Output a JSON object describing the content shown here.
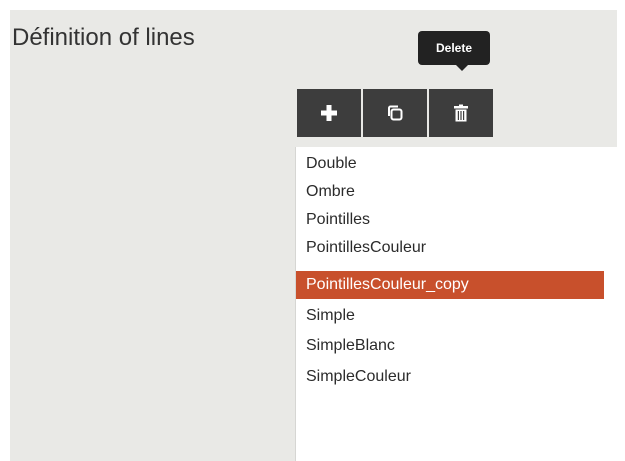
{
  "section": {
    "title": "Définition of lines"
  },
  "tooltip": {
    "text": "Delete"
  },
  "toolbar": {
    "buttons": [
      {
        "name": "add",
        "icon": "plus-icon"
      },
      {
        "name": "copy",
        "icon": "copy-icon"
      },
      {
        "name": "delete",
        "icon": "trash-icon"
      }
    ]
  },
  "line_list": {
    "items": [
      "Double",
      "Ombre",
      "Pointilles",
      "PointillesCouleur",
      "PointillesCouleur_copy",
      "Simple",
      "SimpleBlanc",
      "SimpleCouleur"
    ],
    "selected": "PointillesCouleur_copy"
  },
  "colors": {
    "panel_bg": "#e9e9e6",
    "button_bg": "#3d3d3d",
    "selected_bg": "#c8502c",
    "tooltip_bg": "#222222"
  }
}
